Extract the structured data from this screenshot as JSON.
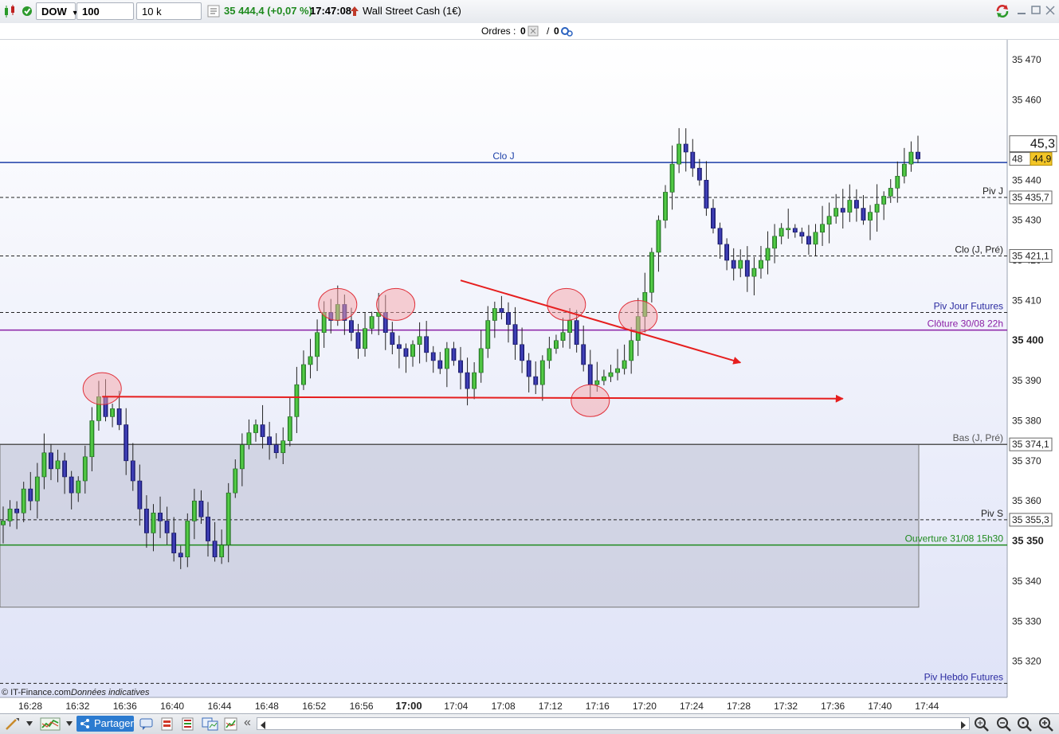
{
  "toolbar": {
    "instrument": "DOW",
    "ticks": "100 ticks",
    "units": "10 k unités",
    "price_change": "35 444,4 (+0,07 %)",
    "time": "17:47:08",
    "name": "Wall Street Cash (1€)"
  },
  "orders": {
    "label": "Ordres :",
    "count1": "0",
    "count2": "0",
    "slash": "/"
  },
  "footer": {
    "copyright": "© IT-Finance.com",
    "note": "Données indicatives"
  },
  "bottom": {
    "share_label": "Partager",
    "scroll_left": "«"
  },
  "chart_data": {
    "type": "candlestick",
    "instrument": "Wall Street Cash (1€)",
    "ylim": [
      35311,
      35475
    ],
    "y_ticks": [
      35320,
      35330,
      35340,
      35350,
      35360,
      35370,
      35380,
      35390,
      35400,
      35410,
      35420,
      35430,
      35440,
      35450,
      35460,
      35470
    ],
    "y_tick_labels": [
      "35 320",
      "35 330",
      "35 340",
      "35 350",
      "35 360",
      "35 370",
      "35 380",
      "35 390",
      "35 400",
      "35 410",
      "35 420",
      "35 430",
      "35 440",
      "35 450",
      "35 460",
      "35 470"
    ],
    "y_bold_ticks": [
      35350,
      35400
    ],
    "x_tick_labels": [
      "16:28",
      "16:32",
      "16:36",
      "16:40",
      "16:44",
      "16:48",
      "16:52",
      "16:56",
      "17:00",
      "17:04",
      "17:08",
      "17:12",
      "17:16",
      "17:20",
      "17:24",
      "17:28",
      "17:32",
      "17:36",
      "17:40",
      "17:44"
    ],
    "x_bold_ticks": [
      "17:00"
    ],
    "last_price_label": "45,3",
    "bid_label": "44,9",
    "ask_label": "48",
    "levels": [
      {
        "name": "Clo J",
        "value": 35444.4,
        "style": "solid",
        "color": "#1c3fa8",
        "label_pos": "center"
      },
      {
        "name": "Piv J",
        "value": 35435.7,
        "style": "dashed",
        "color": "#222222",
        "tag": "35 435,7"
      },
      {
        "name": "Clo (J, Pré)",
        "value": 35421.1,
        "style": "dashed",
        "color": "#222222",
        "tag": "35 421,1"
      },
      {
        "name": "Piv Jour Futures",
        "value": 35407,
        "style": "dashed",
        "color": "#222222",
        "label_color": "#2a2aa0"
      },
      {
        "name": "Clôture 30/08 22h",
        "value": 35402.6,
        "style": "solid",
        "color": "#8a1fa6",
        "label_color": "#8a1fa6"
      },
      {
        "name": "Bas (J, Pré)",
        "value": 35374.1,
        "style": "solid",
        "color": "#555555",
        "tag": "35 374,1"
      },
      {
        "name": "Piv S",
        "value": 35355.3,
        "style": "dashed",
        "color": "#222222",
        "tag": "35 355,3"
      },
      {
        "name": "Ouverture 31/08 15h30",
        "value": 35349,
        "style": "solid",
        "color": "#1e8a1e",
        "label_color": "#1e8a1e"
      },
      {
        "name": "Piv Hebdo Futures",
        "value": 35314.5,
        "style": "dashed",
        "color": "#222222",
        "label_color": "#2a2aa0"
      }
    ],
    "path": [
      35355,
      35358,
      35357,
      35363,
      35360,
      35366,
      35372,
      35368,
      35370,
      35366,
      35362,
      35365,
      35371,
      35380,
      35386,
      35381,
      35383,
      35379,
      35370,
      35365,
      35358,
      35352,
      35357,
      35355,
      35352,
      35347,
      35346,
      35355,
      35360,
      35356,
      35350,
      35346,
      35349,
      35362,
      35368,
      35374,
      35377,
      35379,
      35376,
      35374,
      35372,
      35375,
      35381,
      35389,
      35394,
      35396,
      35402,
      35407,
      35405,
      35409,
      35405,
      35402,
      35398,
      35403,
      35406,
      35407,
      35402,
      35399,
      35398,
      35396,
      35399,
      35401,
      35397,
      35395,
      35393,
      35398,
      35395,
      35392,
      35388,
      35392,
      35398,
      35405,
      35408,
      35407,
      35404,
      35399,
      35395,
      35391,
      35389,
      35395,
      35398,
      35400,
      35402,
      35405,
      35399,
      35394,
      35389,
      35390,
      35391,
      35392,
      35393,
      35395,
      35400,
      35406,
      35412,
      35422,
      35430,
      35437,
      35444,
      35449,
      35447,
      35443,
      35440,
      35433,
      35428,
      35424,
      35420,
      35418,
      35420,
      35416,
      35418,
      35420,
      35423,
      35426,
      35428,
      35428,
      35427,
      35426,
      35424,
      35427,
      35429,
      35431,
      35433,
      35432,
      35435,
      35433,
      35430,
      35432,
      35434,
      35436,
      35438,
      35441,
      35444,
      35447,
      35445.3
    ],
    "annotations": [
      {
        "type": "ellipse",
        "time_index": 14.5,
        "value": 35388
      },
      {
        "type": "ellipse",
        "time_index": 49,
        "value": 35409
      },
      {
        "type": "ellipse",
        "time_index": 57.5,
        "value": 35409
      },
      {
        "type": "ellipse",
        "time_index": 82.5,
        "value": 35409
      },
      {
        "type": "ellipse",
        "time_index": 86,
        "value": 35385
      },
      {
        "type": "ellipse",
        "time_index": 93,
        "value": 35406
      },
      {
        "type": "arrow",
        "from_index": 14.5,
        "from_value": 35386,
        "to_index": 123,
        "to_value": 35385.5
      },
      {
        "type": "arrow",
        "from_index": 67,
        "from_value": 35415,
        "to_index": 108,
        "to_value": 35394.5
      }
    ]
  }
}
